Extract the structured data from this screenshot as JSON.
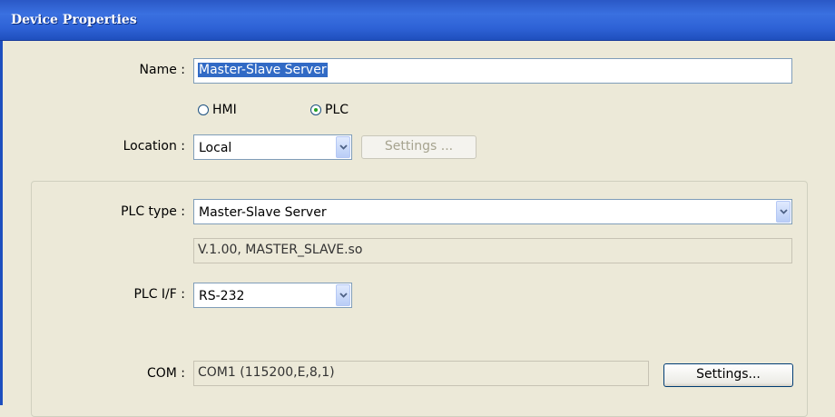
{
  "window": {
    "title": "Device Properties"
  },
  "name_field": {
    "label": "Name :",
    "value": "Master-Slave Server"
  },
  "device_kind": {
    "options": [
      {
        "label": "HMI",
        "checked": false
      },
      {
        "label": "PLC",
        "checked": true
      }
    ]
  },
  "location": {
    "label": "Location :",
    "value": "Local",
    "settings_label": "Settings ..."
  },
  "plc_type": {
    "label": "PLC type :",
    "value": "Master-Slave Server",
    "version": "V.1.00, MASTER_SLAVE.so"
  },
  "plc_if": {
    "label": "PLC I/F :",
    "value": "RS-232"
  },
  "com": {
    "label": "COM :",
    "value": "COM1 (115200,E,8,1)",
    "settings_label": "Settings..."
  }
}
